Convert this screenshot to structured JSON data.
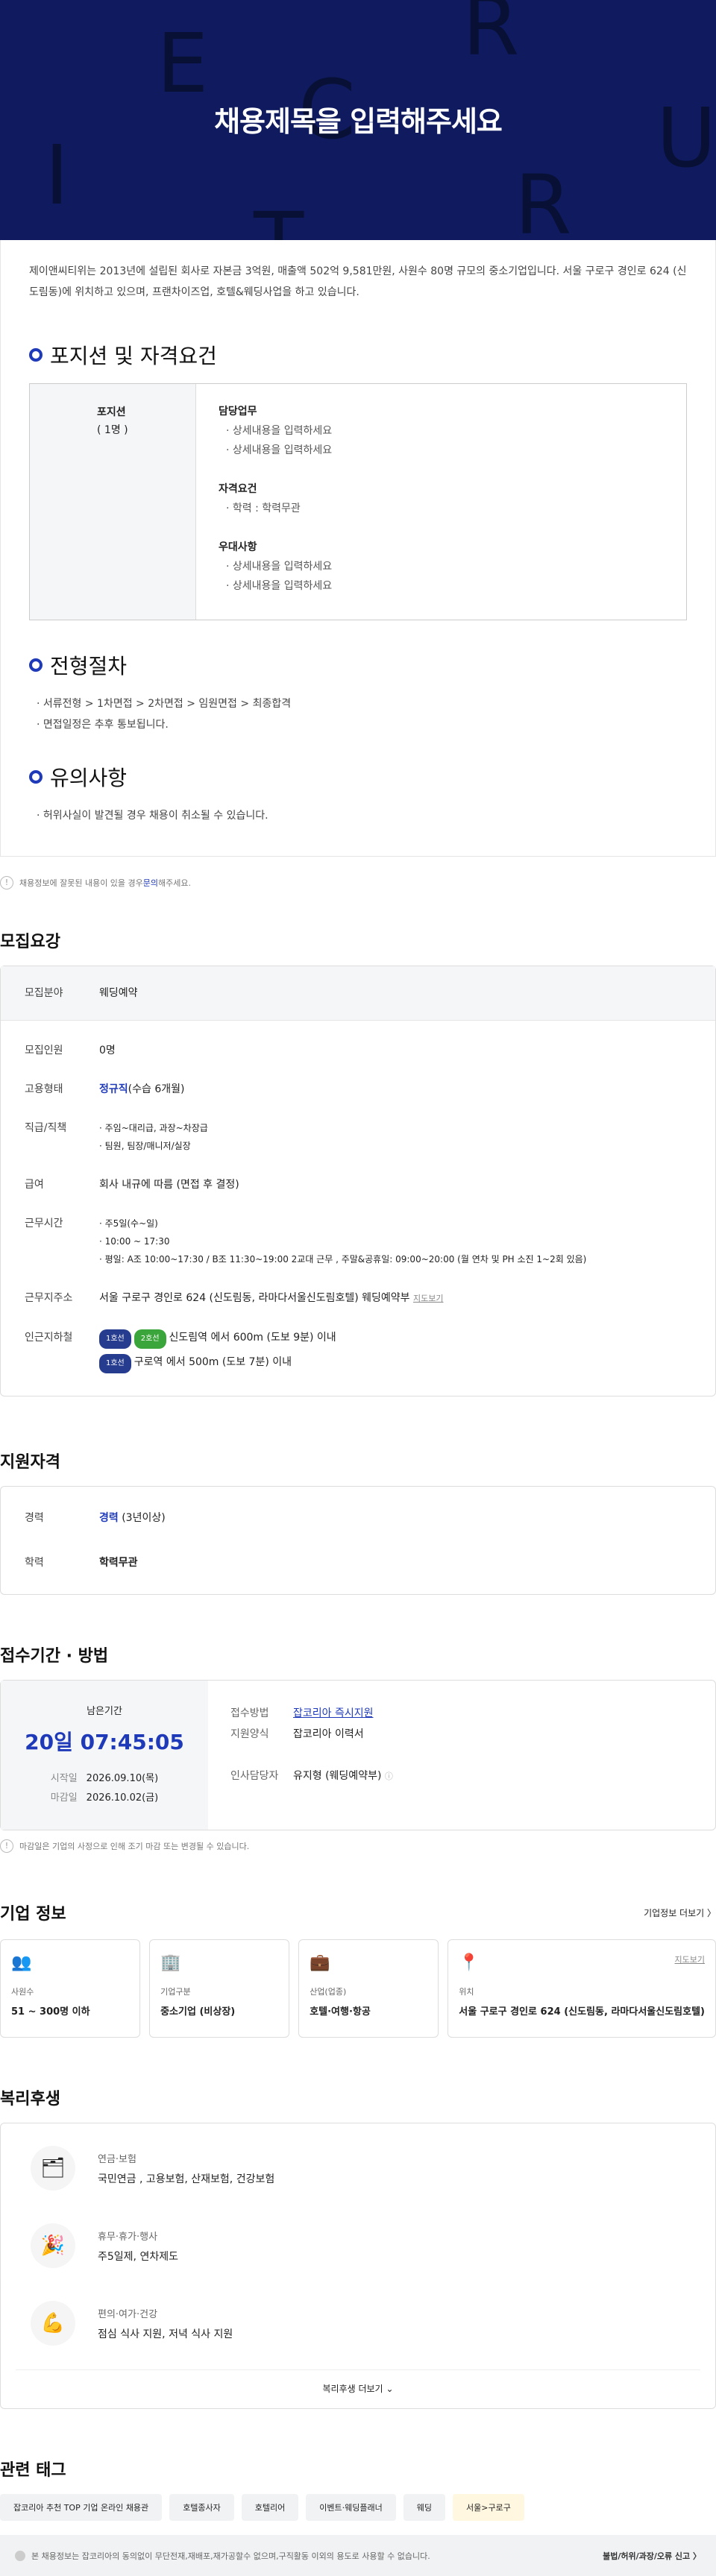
{
  "hero": {
    "title": "채용제목을 입력해주세요",
    "letters": [
      "E",
      "R",
      "C",
      "I",
      "R",
      "U",
      "T"
    ]
  },
  "intro": "제이앤씨티위는 2013년에 설립된 회사로 자본금 3억원, 매출액 502억 9,581만원, 사원수 80명 규모의 중소기업입니다. 서울 구로구 경인로 624 (신도림동)에 위치하고 있으며, 프랜차이즈업, 호텔&웨딩사업을 하고 있습니다.",
  "positions": {
    "title": "포지션 및 자격요건",
    "label": "포지션",
    "count": "( 1명 )",
    "duty_h": "담당업무",
    "duties": [
      "상세내용을 입력하세요",
      "상세내용을 입력하세요"
    ],
    "req_h": "자격요건",
    "reqs": [
      "학력 : 학력무관"
    ],
    "pref_h": "우대사항",
    "prefs": [
      "상세내용을 입력하세요",
      "상세내용을 입력하세요"
    ]
  },
  "process": {
    "title": "전형절차",
    "lines": [
      "서류전형 > 1차면접 > 2차면접 > 임원면접 > 최종합격",
      "면접일정은 추후 통보됩니다."
    ]
  },
  "caution": {
    "title": "유의사항",
    "lines": [
      "허위사실이 발견될 경우 채용이 취소될 수 있습니다."
    ]
  },
  "report": {
    "text": "채용정보에 잘못된 내용이 있을 경우 ",
    "link": "문의",
    "tail": "해주세요."
  },
  "recruit": {
    "title": "모집요강",
    "field_k": "모집분야",
    "field_v": "웨딩예약",
    "rows": [
      {
        "k": "모집인원",
        "v": "0명"
      },
      {
        "k": "고용형태",
        "v": "정규직",
        "v2": "(수습 6개월)"
      },
      {
        "k": "직급/직책",
        "l1": "주임~대리급, 과장~차장급",
        "l2": "팀원, 팀장/매니저/실장"
      },
      {
        "k": "급여",
        "v": "회사 내규에 따름 (면접 후 결정)"
      },
      {
        "k": "근무시간",
        "l1": "주5일(수~일)",
        "l2": "10:00 ~ 17:30",
        "l3": "평일: A조 10:00~17:30 / B조 11:30~19:00 2교대 근무 , 주말&공휴일: 09:00~20:00 (월 연차 및 PH 소진 1~2회 있음)"
      },
      {
        "k": "근무지주소",
        "v": "서울 구로구 경인로 624 (신도림동, 라마다서울신도림호텔) 웨딩예약부",
        "link": "지도보기"
      },
      {
        "k": "인근지하철",
        "s1b1": "1호선",
        "s1b2": "2호선",
        "s1": "신도림역 에서 600m (도보 9분) 이내",
        "s2b1": "1호선",
        "s2": "구로역 에서 500m (도보 7분) 이내"
      }
    ]
  },
  "qual": {
    "title": "지원자격",
    "k1": "경력",
    "v1": "경력",
    "v1b": "(3년이상)",
    "k2": "학력",
    "v2": "학력무관"
  },
  "apply": {
    "title": "접수기간 · 방법",
    "remain_k": "남은기간",
    "remain_v": "20일 07:45:05",
    "start_k": "시작일",
    "start_v": "2026.09.10(목)",
    "end_k": "마감일",
    "end_v": "2026.10.02(금)",
    "method_k": "접수방법",
    "method_v": "잡코리아 즉시지원",
    "form_k": "지원양식",
    "form_v": "잡코리아 이력서",
    "contact_k": "인사담당자",
    "contact_v": "유지형 (웨딩예약부)",
    "note": "마감일은 기업의 사정으로 인해 조기 마감 또는 변경될 수 있습니다."
  },
  "company": {
    "title": "기업 정보",
    "more": "기업정보 더보기 〉",
    "cards": [
      {
        "k": "사원수",
        "v": "51 ~ 300명 이하",
        "icon": "people-icon"
      },
      {
        "k": "기업구분",
        "v": "중소기업 (비상장)",
        "icon": "building-icon"
      },
      {
        "k": "산업(업종)",
        "v": "호텔·여행·항공",
        "icon": "briefcase-icon"
      },
      {
        "k": "위치",
        "v": "서울 구로구 경인로 624 (신도림동, 라마다서울신도림호텔)",
        "icon": "pin-icon",
        "link": "지도보기"
      }
    ]
  },
  "welfare": {
    "title": "복리후생",
    "items": [
      {
        "k": "연금·보험",
        "v": "국민연금 , 고용보험, 산재보험, 건강보험",
        "icon": "🗂"
      },
      {
        "k": "휴무·휴가·행사",
        "v": "주5일제, 연차제도",
        "icon": "🎉"
      },
      {
        "k": "편의·여가·건강",
        "v": "점심 식사 지원, 저녁 식사 지원",
        "icon": "💪"
      }
    ],
    "more": "복리후생 더보기"
  },
  "tags": {
    "title": "관련 태그",
    "items": [
      "잡코리아 추천 TOP 기업 온라인 채용관",
      "호텔종사자",
      "호텔리어",
      "이벤트·웨딩플래너",
      "웨딩",
      "서울>구로구"
    ]
  },
  "footer": {
    "text": "본 채용정보는 잡코리아의 동의없이 무단전재,재배포,재가공할수 없으며,구직활동 이외의 용도로 사용할 수 없습니다.",
    "report": "불법/허위/과장/오류 신고 〉"
  },
  "colors": {
    "hero_bg": "#0f1b5e",
    "accent": "#1f3ab8"
  }
}
